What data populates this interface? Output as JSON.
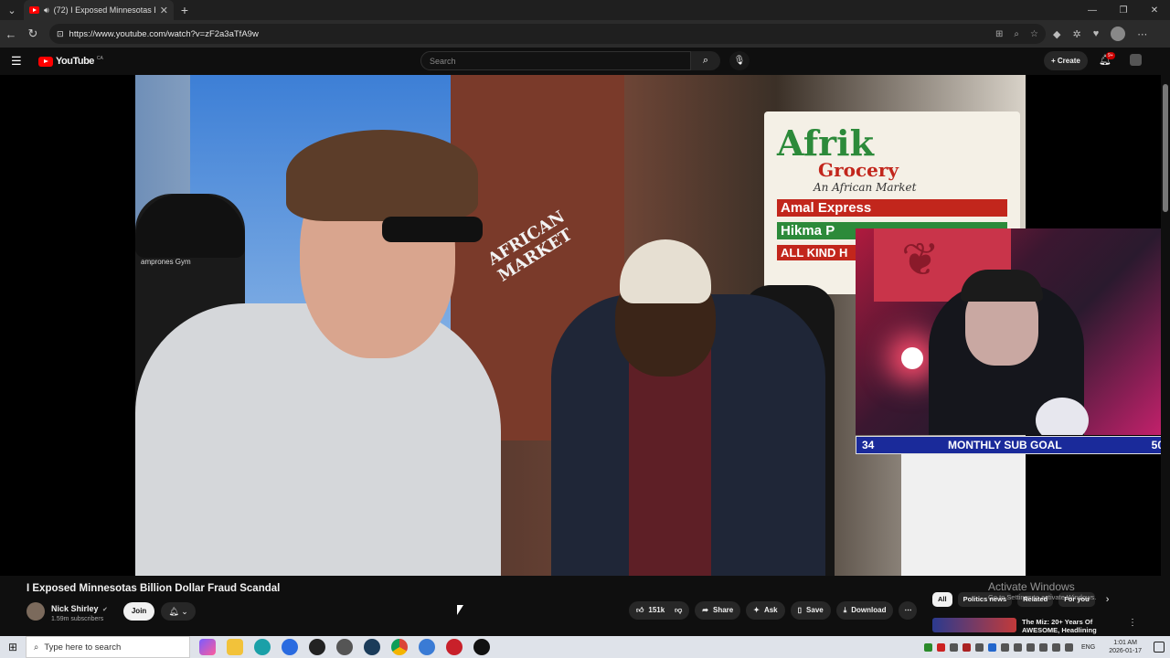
{
  "browser": {
    "tab_title": "(72) I Exposed Minnesotas B",
    "url": "https://www.youtube.com/watch?v=zF2a3aTfA9w"
  },
  "youtube": {
    "logo_text": "YouTube",
    "region": "CA",
    "search_placeholder": "Search",
    "create_label": "Create",
    "notification_count": "9+"
  },
  "video": {
    "sign": {
      "afrik": "Afrik",
      "grocery": "Grocery",
      "african_market": "An African Market",
      "amal": "Amal Express",
      "hikma": "Hikma P",
      "all_kind": "ALL KIND H",
      "side_sign": "AFRICAN MARKET",
      "beanie_text": "amprones Gym"
    },
    "overlay": {
      "sub_current": "34",
      "sub_label": "MONTHLY SUB GOAL",
      "sub_goal": "50"
    },
    "title": "I Exposed Minnesotas Billion Dollar Fraud Scandal"
  },
  "channel": {
    "name": "Nick Shirley",
    "subscribers": "1.59m subscribers",
    "join_label": "Join"
  },
  "actions": {
    "likes": "151k",
    "share": "Share",
    "ask": "Ask",
    "save": "Save",
    "download": "Download"
  },
  "filters": [
    "All",
    "Politics news",
    "Related",
    "For you"
  ],
  "watermark": {
    "title": "Activate Windows",
    "subtitle": "Go to Settings to activate Windows."
  },
  "recommendation": {
    "title": "The Miz: 20+ Years Of AWESOME, Headlining"
  },
  "taskbar": {
    "search_placeholder": "Type here to search",
    "lang": "ENG",
    "time": "1:01 AM",
    "date": "2026-01-17"
  },
  "colors": {
    "youtube_red": "#ff0000",
    "sub_goal_bar": "#1a2a9a",
    "page_bg": "#0f0f0f"
  }
}
